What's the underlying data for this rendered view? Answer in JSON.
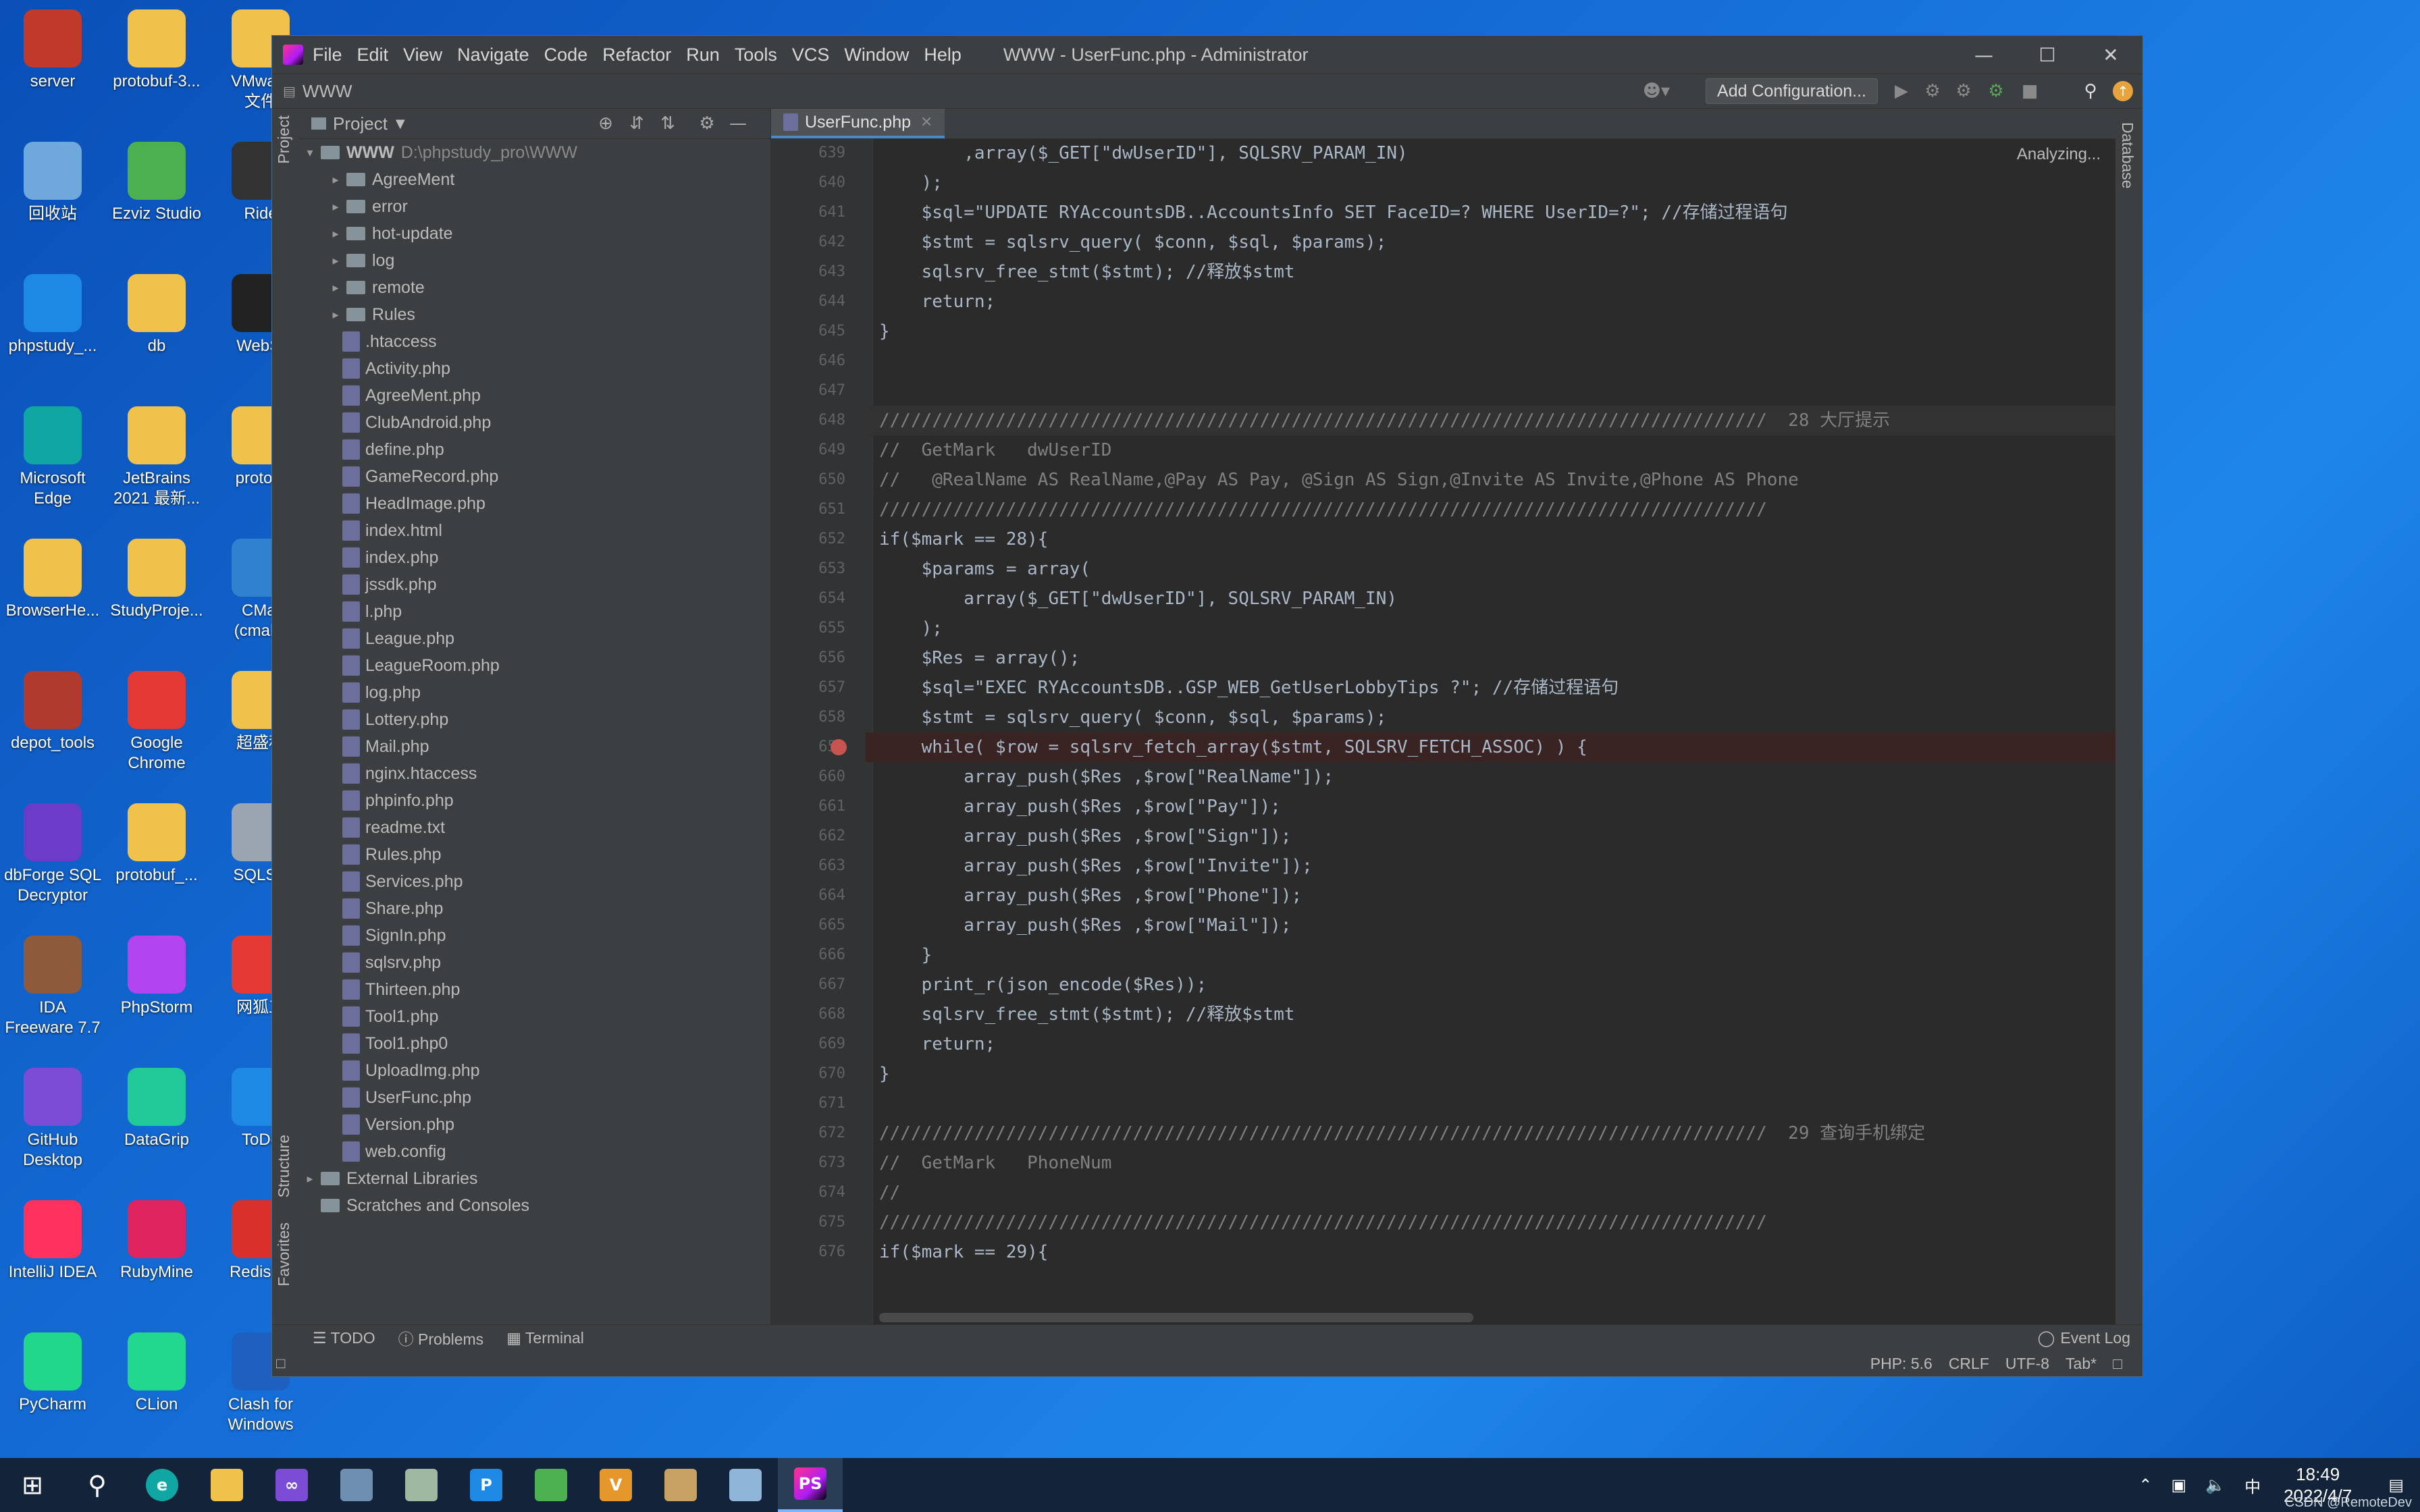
{
  "desktop_icons": [
    {
      "label": "server",
      "color": "#c0392b"
    },
    {
      "label": "protobuf-3...",
      "color": "#f0c14b"
    },
    {
      "label": "VMware\n文件",
      "color": "#f0c14b"
    },
    {
      "label": "回收站",
      "color": "#6fa8dc"
    },
    {
      "label": "Ezviz Studio",
      "color": "#4caf50"
    },
    {
      "label": "Ride",
      "color": "#333333"
    },
    {
      "label": "phpstudy_...",
      "color": "#1e88e5"
    },
    {
      "label": "db",
      "color": "#f0c14b"
    },
    {
      "label": "WebSt",
      "color": "#222222"
    },
    {
      "label": "Microsoft\nEdge",
      "color": "#0fa6a3"
    },
    {
      "label": "JetBrains\n2021 最新...",
      "color": "#f0c14b"
    },
    {
      "label": "protoc-",
      "color": "#f0c14b"
    },
    {
      "label": "BrowserHe...",
      "color": "#f0c14b"
    },
    {
      "label": "StudyProje...",
      "color": "#f0c14b"
    },
    {
      "label": "CMal\n(cmake",
      "color": "#3182ce"
    },
    {
      "label": "depot_tools",
      "color": "#b03a2e"
    },
    {
      "label": "Google\nChrome",
      "color": "#e53935"
    },
    {
      "label": "超盛科",
      "color": "#f0c14b"
    },
    {
      "label": "dbForge SQL\nDecryptor",
      "color": "#6a3cc8"
    },
    {
      "label": "protobuf_...",
      "color": "#f0c14b"
    },
    {
      "label": "SQLSR",
      "color": "#9aa5b1"
    },
    {
      "label": "IDA\nFreeware 7.7",
      "color": "#8d5b3b"
    },
    {
      "label": "PhpStorm",
      "color": "#b345f1"
    },
    {
      "label": "网狐工",
      "color": "#e53935"
    },
    {
      "label": "GitHub\nDesktop",
      "color": "#7b4dd6"
    },
    {
      "label": "DataGrip",
      "color": "#20c997"
    },
    {
      "label": "ToDe",
      "color": "#1e88e5"
    },
    {
      "label": "IntelliJ IDEA",
      "color": "#fe315d"
    },
    {
      "label": "RubyMine",
      "color": "#e0245e"
    },
    {
      "label": "RedisDe",
      "color": "#d9302b"
    },
    {
      "label": "PyCharm",
      "color": "#21d789"
    },
    {
      "label": "CLion",
      "color": "#22d88f"
    },
    {
      "label": "Clash for\nWindows",
      "color": "#1f5fbf"
    }
  ],
  "taskbar": {
    "time": "18:49",
    "date": "2022/4/7",
    "ime": "中",
    "watermark": "CSDN @RemoteDev"
  },
  "window": {
    "menus": [
      "File",
      "Edit",
      "View",
      "Navigate",
      "Code",
      "Refactor",
      "Run",
      "Tools",
      "VCS",
      "Window",
      "Help"
    ],
    "title": "WWW - UserFunc.php - Administrator",
    "breadcrumb": "WWW",
    "add_config": "Add Configuration...",
    "analyzing": "Analyzing...",
    "right_tab": "Database",
    "left_tabs": {
      "project": "Project",
      "structure": "Structure",
      "favorites": "Favorites"
    }
  },
  "project": {
    "header": "Project",
    "root_name": "WWW",
    "root_path": "D:\\phpstudy_pro\\WWW",
    "folders": [
      "AgreeMent",
      "error",
      "hot-update",
      "log",
      "remote",
      "Rules"
    ],
    "files": [
      ".htaccess",
      "Activity.php",
      "AgreeMent.php",
      "ClubAndroid.php",
      "define.php",
      "GameRecord.php",
      "HeadImage.php",
      "index.html",
      "index.php",
      "jssdk.php",
      "l.php",
      "League.php",
      "LeagueRoom.php",
      "log.php",
      "Lottery.php",
      "Mail.php",
      "nginx.htaccess",
      "phpinfo.php",
      "readme.txt",
      "Rules.php",
      "Services.php",
      "Share.php",
      "SignIn.php",
      "sqlsrv.php",
      "Thirteen.php",
      "Tool1.php",
      "Tool1.php0",
      "UploadImg.php",
      "UserFunc.php",
      "Version.php",
      "web.config"
    ],
    "extras": [
      "External Libraries",
      "Scratches and Consoles"
    ]
  },
  "editor": {
    "tab": "UserFunc.php",
    "lines": [
      {
        "n": "639",
        "t": "        ,array($_GET[\"dwUserID\"], SQLSRV_PARAM_IN)"
      },
      {
        "n": "640",
        "t": "    );"
      },
      {
        "n": "641",
        "t": "    $sql=\"UPDATE RYAccountsDB..AccountsInfo SET FaceID=? WHERE UserID=?\"; //存储过程语句"
      },
      {
        "n": "642",
        "t": "    $stmt = sqlsrv_query( $conn, $sql, $params);"
      },
      {
        "n": "643",
        "t": "    sqlsrv_free_stmt($stmt); //释放$stmt"
      },
      {
        "n": "644",
        "t": "    return;"
      },
      {
        "n": "645",
        "t": "}"
      },
      {
        "n": "646",
        "t": ""
      },
      {
        "n": "647",
        "t": ""
      },
      {
        "n": "648",
        "t": "////////////////////////////////////////////////////////////////////////////////////  28 大厅提示"
      },
      {
        "n": "649",
        "t": "//  GetMark   dwUserID"
      },
      {
        "n": "650",
        "t": "//   @RealName AS RealName,@Pay AS Pay, @Sign AS Sign,@Invite AS Invite,@Phone AS Phone"
      },
      {
        "n": "651",
        "t": "////////////////////////////////////////////////////////////////////////////////////"
      },
      {
        "n": "652",
        "t": "if($mark == 28){"
      },
      {
        "n": "653",
        "t": "    $params = array("
      },
      {
        "n": "654",
        "t": "        array($_GET[\"dwUserID\"], SQLSRV_PARAM_IN)"
      },
      {
        "n": "655",
        "t": "    );"
      },
      {
        "n": "656",
        "t": "    $Res = array();"
      },
      {
        "n": "657",
        "t": "    $sql=\"EXEC RYAccountsDB..GSP_WEB_GetUserLobbyTips ?\"; //存储过程语句"
      },
      {
        "n": "658",
        "t": "    $stmt = sqlsrv_query( $conn, $sql, $params);"
      },
      {
        "n": "659",
        "t": "    while( $row = sqlsrv_fetch_array($stmt, SQLSRV_FETCH_ASSOC) ) {"
      },
      {
        "n": "660",
        "t": "        array_push($Res ,$row[\"RealName\"]);"
      },
      {
        "n": "661",
        "t": "        array_push($Res ,$row[\"Pay\"]);"
      },
      {
        "n": "662",
        "t": "        array_push($Res ,$row[\"Sign\"]);"
      },
      {
        "n": "663",
        "t": "        array_push($Res ,$row[\"Invite\"]);"
      },
      {
        "n": "664",
        "t": "        array_push($Res ,$row[\"Phone\"]);"
      },
      {
        "n": "665",
        "t": "        array_push($Res ,$row[\"Mail\"]);"
      },
      {
        "n": "666",
        "t": "    }"
      },
      {
        "n": "667",
        "t": "    print_r(json_encode($Res));"
      },
      {
        "n": "668",
        "t": "    sqlsrv_free_stmt($stmt); //释放$stmt"
      },
      {
        "n": "669",
        "t": "    return;"
      },
      {
        "n": "670",
        "t": "}"
      },
      {
        "n": "671",
        "t": ""
      },
      {
        "n": "672",
        "t": "////////////////////////////////////////////////////////////////////////////////////  29 查询手机绑定"
      },
      {
        "n": "673",
        "t": "//  GetMark   PhoneNum"
      },
      {
        "n": "674",
        "t": "//"
      },
      {
        "n": "675",
        "t": "////////////////////////////////////////////////////////////////////////////////////"
      },
      {
        "n": "676",
        "t": "if($mark == 29){"
      }
    ],
    "breakpoint_line": "659",
    "current_line": "648"
  },
  "bottom": {
    "todo": "TODO",
    "problems": "Problems",
    "terminal": "Terminal",
    "event_log": "Event Log",
    "php": "PHP: 5.6",
    "crlf": "CRLF",
    "encoding": "UTF-8",
    "indent": "Tab*"
  },
  "colors": {
    "breakpoint": "#c75450",
    "breakpoint_line_bg": "#3a2323",
    "caret_row_bg": "#323232",
    "accent": "#4a88c7"
  }
}
